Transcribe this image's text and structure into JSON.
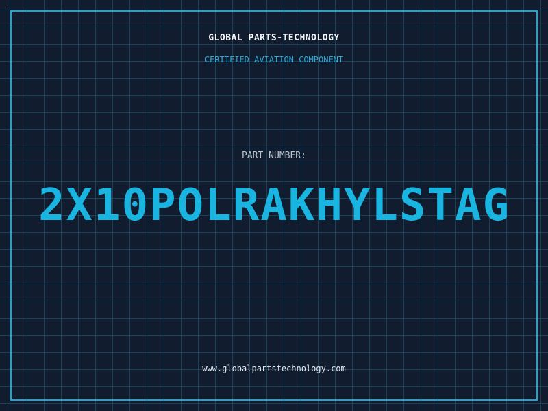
{
  "label": {
    "company": "GLOBAL PARTS-TECHNOLOGY",
    "subtitle": "CERTIFIED AVIATION COMPONENT",
    "part_number_label": "PART NUMBER:",
    "part_number": "2X10POLRAKHYLSTAG",
    "website": "www.globalpartstechnology.com"
  },
  "colors": {
    "background": "#111c2e",
    "grid": "#1e5f7d",
    "frame": "#1aa7cf",
    "accent": "#1ab4e0"
  }
}
